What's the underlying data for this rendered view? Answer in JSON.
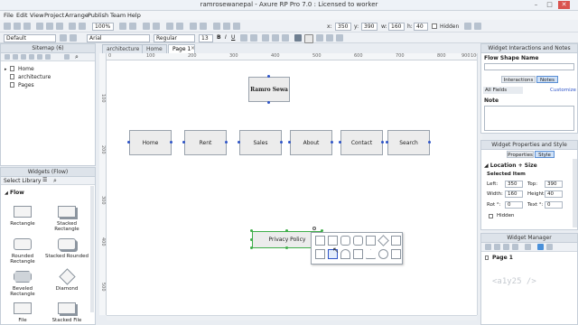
{
  "window": {
    "title": "ramrosewanepal - Axure RP Pro 7.0 : Licensed to worker"
  },
  "menu": [
    "File",
    "Edit",
    "View",
    "Project",
    "Arrange",
    "Publish",
    "Team",
    "Help"
  ],
  "toolbar": {
    "zoom": "100%",
    "x_label": "x:",
    "x_value": "350",
    "y_label": "y:",
    "y_value": "390",
    "w_label": "w:",
    "w_value": "160",
    "h_label": "h:",
    "h_value": "40",
    "hidden_label": "Hidden"
  },
  "toolbar2": {
    "style": "Default",
    "font": "Arial",
    "weight": "Regular",
    "size": "13"
  },
  "sitemap": {
    "title": "Sitemap (6)",
    "items": [
      "Home",
      "architecture",
      "Pages"
    ]
  },
  "tabs": [
    "architecture",
    "Home",
    "Page 1"
  ],
  "rulers": {
    "h": [
      "0",
      "100",
      "200",
      "300",
      "400",
      "500",
      "600",
      "700",
      "800",
      "900",
      "1000"
    ],
    "v": [
      "100",
      "200",
      "300",
      "400",
      "500"
    ]
  },
  "canvas": {
    "logo": "Ramro Sewa",
    "nav": [
      "Home",
      "Rent",
      "Sales",
      "About",
      "Contact",
      "Search"
    ],
    "selected": "Privacy Policy"
  },
  "widgets_panel": {
    "title": "Widgets (Flow)",
    "library": "Select Library",
    "group": "Flow",
    "items": [
      "Rectangle",
      "Stacked Rectangle",
      "Rounded Rectangle",
      "Stacked Rounded",
      "Beveled Rectangle",
      "Diamond",
      "File",
      "Stacked File"
    ]
  },
  "interactions_panel": {
    "title": "Widget Interactions and Notes",
    "shape_name_label": "Flow Shape Name",
    "tabs": [
      "Interactions",
      "Notes"
    ],
    "fields_select": "All Fields",
    "customize": "Customize",
    "note_label": "Note"
  },
  "properties_panel": {
    "title": "Widget Properties and Style",
    "tabs": [
      "Properties",
      "Style"
    ],
    "section": "Location + Size",
    "selected_group": "Selected Item",
    "left_label": "Left:",
    "left_value": "350",
    "top_label": "Top:",
    "top_value": "390",
    "width_label": "Width:",
    "width_value": "160",
    "height_label": "Height:",
    "height_value": "40",
    "rot_label": "Rot °:",
    "rot_value": "0",
    "text_label": "Text °:",
    "text_value": "0",
    "hidden_label": "Hidden"
  },
  "manager_panel": {
    "title": "Widget Manager",
    "item": "Page 1"
  },
  "watermark": "<a1y25 />"
}
